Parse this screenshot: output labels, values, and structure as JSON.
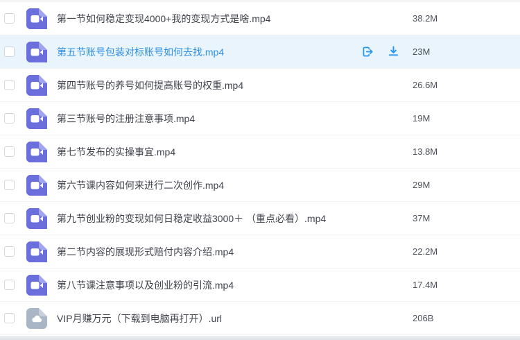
{
  "colors": {
    "action_icon_blue": "#2196f3",
    "highlight_row_bg": "#e9f4fd",
    "highlight_filename_blue": "#2e8fe4",
    "video_icon_purple": "#6b6fdc",
    "video_icon_fold": "#9fa4ec",
    "url_icon_gray": "#a9b6c5",
    "url_icon_fold": "#c8d1db"
  },
  "icons": {
    "video_file": "video-camera-icon",
    "url_file": "cloud-icon",
    "share": "share-export-icon",
    "download": "download-icon",
    "checkbox": "checkbox-unchecked"
  },
  "rows": [
    {
      "name": "第一节如何稳定变现4000+我的变现方式是啥.mp4",
      "size": "38.2M",
      "type": "video",
      "highlighted": false
    },
    {
      "name": "第五节账号包装对标账号如何去找.mp4",
      "size": "23M",
      "type": "video",
      "highlighted": true
    },
    {
      "name": "第四节账号的养号如何提高账号的权重.mp4",
      "size": "26.6M",
      "type": "video",
      "highlighted": false
    },
    {
      "name": "第三节账号的注册注意事项.mp4",
      "size": "19M",
      "type": "video",
      "highlighted": false
    },
    {
      "name": "第七节发布的实操事宜.mp4",
      "size": "13.8M",
      "type": "video",
      "highlighted": false
    },
    {
      "name": "第六节课内容如何来进行二次创作.mp4",
      "size": "29M",
      "type": "video",
      "highlighted": false
    },
    {
      "name": "第九节创业粉的变现如何日稳定收益3000＋ （重点必看）.mp4",
      "size": "37M",
      "type": "video",
      "highlighted": false
    },
    {
      "name": "第二节内容的展现形式赔付内容介绍.mp4",
      "size": "22.2M",
      "type": "video",
      "highlighted": false
    },
    {
      "name": "第八节课注意事项以及创业粉的引流.mp4",
      "size": "17.4M",
      "type": "video",
      "highlighted": false
    },
    {
      "name": "VIP月赚万元（下载到电脑再打开）.url",
      "size": "206B",
      "type": "url",
      "highlighted": false
    }
  ]
}
